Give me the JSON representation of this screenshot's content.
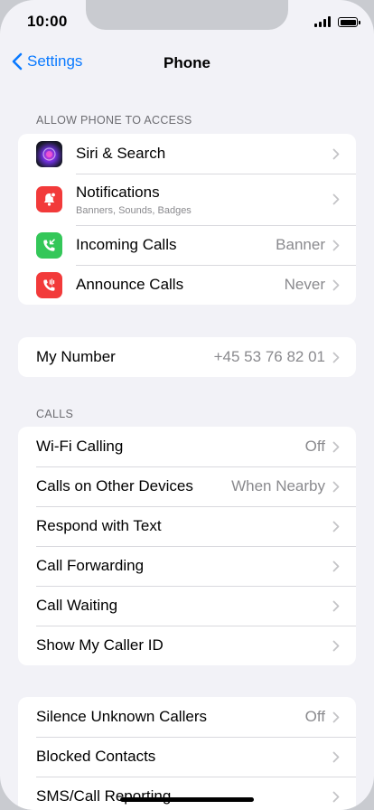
{
  "status_bar": {
    "time": "10:00"
  },
  "nav": {
    "back_label": "Settings",
    "title": "Phone"
  },
  "sections": {
    "access_header": "ALLOW PHONE TO ACCESS",
    "calls_header": "CALLS"
  },
  "access_items": [
    {
      "label": "Siri & Search",
      "icon": "siri-icon"
    },
    {
      "label": "Notifications",
      "sublabel": "Banners, Sounds, Badges",
      "icon": "notifications-icon"
    },
    {
      "label": "Incoming Calls",
      "value": "Banner",
      "icon": "incoming-calls-icon"
    },
    {
      "label": "Announce Calls",
      "value": "Never",
      "icon": "announce-calls-icon"
    }
  ],
  "my_number": {
    "label": "My Number",
    "value": "+45 53 76 82 01"
  },
  "calls_items": [
    {
      "label": "Wi-Fi Calling",
      "value": "Off"
    },
    {
      "label": "Calls on Other Devices",
      "value": "When Nearby"
    },
    {
      "label": "Respond with Text"
    },
    {
      "label": "Call Forwarding"
    },
    {
      "label": "Call Waiting"
    },
    {
      "label": "Show My Caller ID"
    }
  ],
  "blocking_items": [
    {
      "label": "Silence Unknown Callers",
      "value": "Off"
    },
    {
      "label": "Blocked Contacts"
    },
    {
      "label": "SMS/Call Reporting"
    }
  ],
  "colors": {
    "accent": "#0a7aff",
    "background": "#f2f2f7",
    "notifications_red": "#f23a3a",
    "incoming_green": "#34c759",
    "announce_red": "#f23a3a"
  }
}
